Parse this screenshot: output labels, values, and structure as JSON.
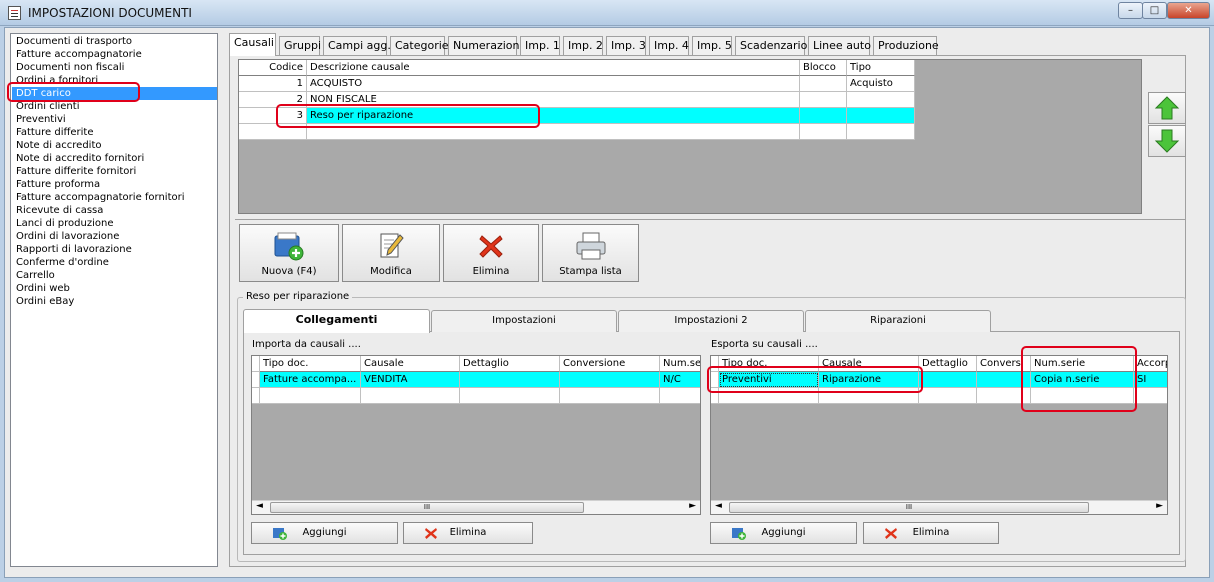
{
  "window": {
    "title": "IMPOSTAZIONI DOCUMENTI",
    "minimize": "–",
    "maximize": "□",
    "close": "✕"
  },
  "doc_types": [
    "Documenti di trasporto",
    "Fatture accompagnatorie",
    "Documenti non fiscali",
    "Ordini a fornitori",
    "DDT carico",
    "Ordini clienti",
    "Preventivi",
    "Fatture differite",
    "Note di accredito",
    "Note di accredito fornitori",
    "Fatture differite fornitori",
    "Fatture proforma",
    "Fatture accompagnatorie fornitori",
    "Ricevute di cassa",
    "Lanci di produzione",
    "Ordini di lavorazione",
    "Rapporti di lavorazione",
    "Conferme d'ordine",
    "Carrello",
    "Ordini web",
    "Ordini eBay"
  ],
  "selected_doc": "DDT carico",
  "tabs": [
    "Causali",
    "Gruppi",
    "Campi agg.",
    "Categorie",
    "Numerazioni",
    "Imp. 1",
    "Imp. 2",
    "Imp. 3",
    "Imp. 4",
    "Imp. 5",
    "Scadenzario",
    "Linee auto",
    "Produzione"
  ],
  "active_tab": "Causali",
  "causali_grid": {
    "headers": [
      "Codice",
      "Descrizione causale",
      "Blocco",
      "Tipo"
    ],
    "rows": [
      {
        "codice": "1",
        "descrizione": "ACQUISTO",
        "blocco": "",
        "tipo": "Acquisto"
      },
      {
        "codice": "2",
        "descrizione": "NON FISCALE",
        "blocco": "",
        "tipo": ""
      },
      {
        "codice": "3",
        "descrizione": "Reso per riparazione",
        "blocco": "",
        "tipo": ""
      }
    ]
  },
  "toolbar": {
    "nuova": "Nuova (F4)",
    "modifica": "Modifica",
    "elimina": "Elimina",
    "stampa": "Stampa lista"
  },
  "group_label": "Reso per riparazione",
  "inner_tabs": [
    "Collegamenti",
    "Impostazioni",
    "Impostazioni 2",
    "Riparazioni"
  ],
  "importa": {
    "label": "Importa da causali ....",
    "headers": [
      "Tipo doc.",
      "Causale",
      "Dettaglio",
      "Conversione",
      "Num.se"
    ],
    "row": [
      "Fatture accompa...",
      "VENDITA",
      "",
      "",
      "N/C"
    ],
    "add": "Aggiungi",
    "del": "Elimina"
  },
  "esporta": {
    "label": "Esporta su causali ....",
    "headers": [
      "Tipo doc.",
      "Causale",
      "Dettaglio",
      "Convers.",
      "Num.serie",
      "Accorp"
    ],
    "row": [
      "Preventivi",
      "Riparazione",
      "",
      "",
      "Copia n.serie",
      "SI"
    ],
    "add": "Aggiungi",
    "del": "Elimina"
  },
  "scroll_grip": "III",
  "colors": {
    "selection": "#00ffff",
    "list_selection": "#3399ff",
    "highlight": "#e0001a"
  }
}
